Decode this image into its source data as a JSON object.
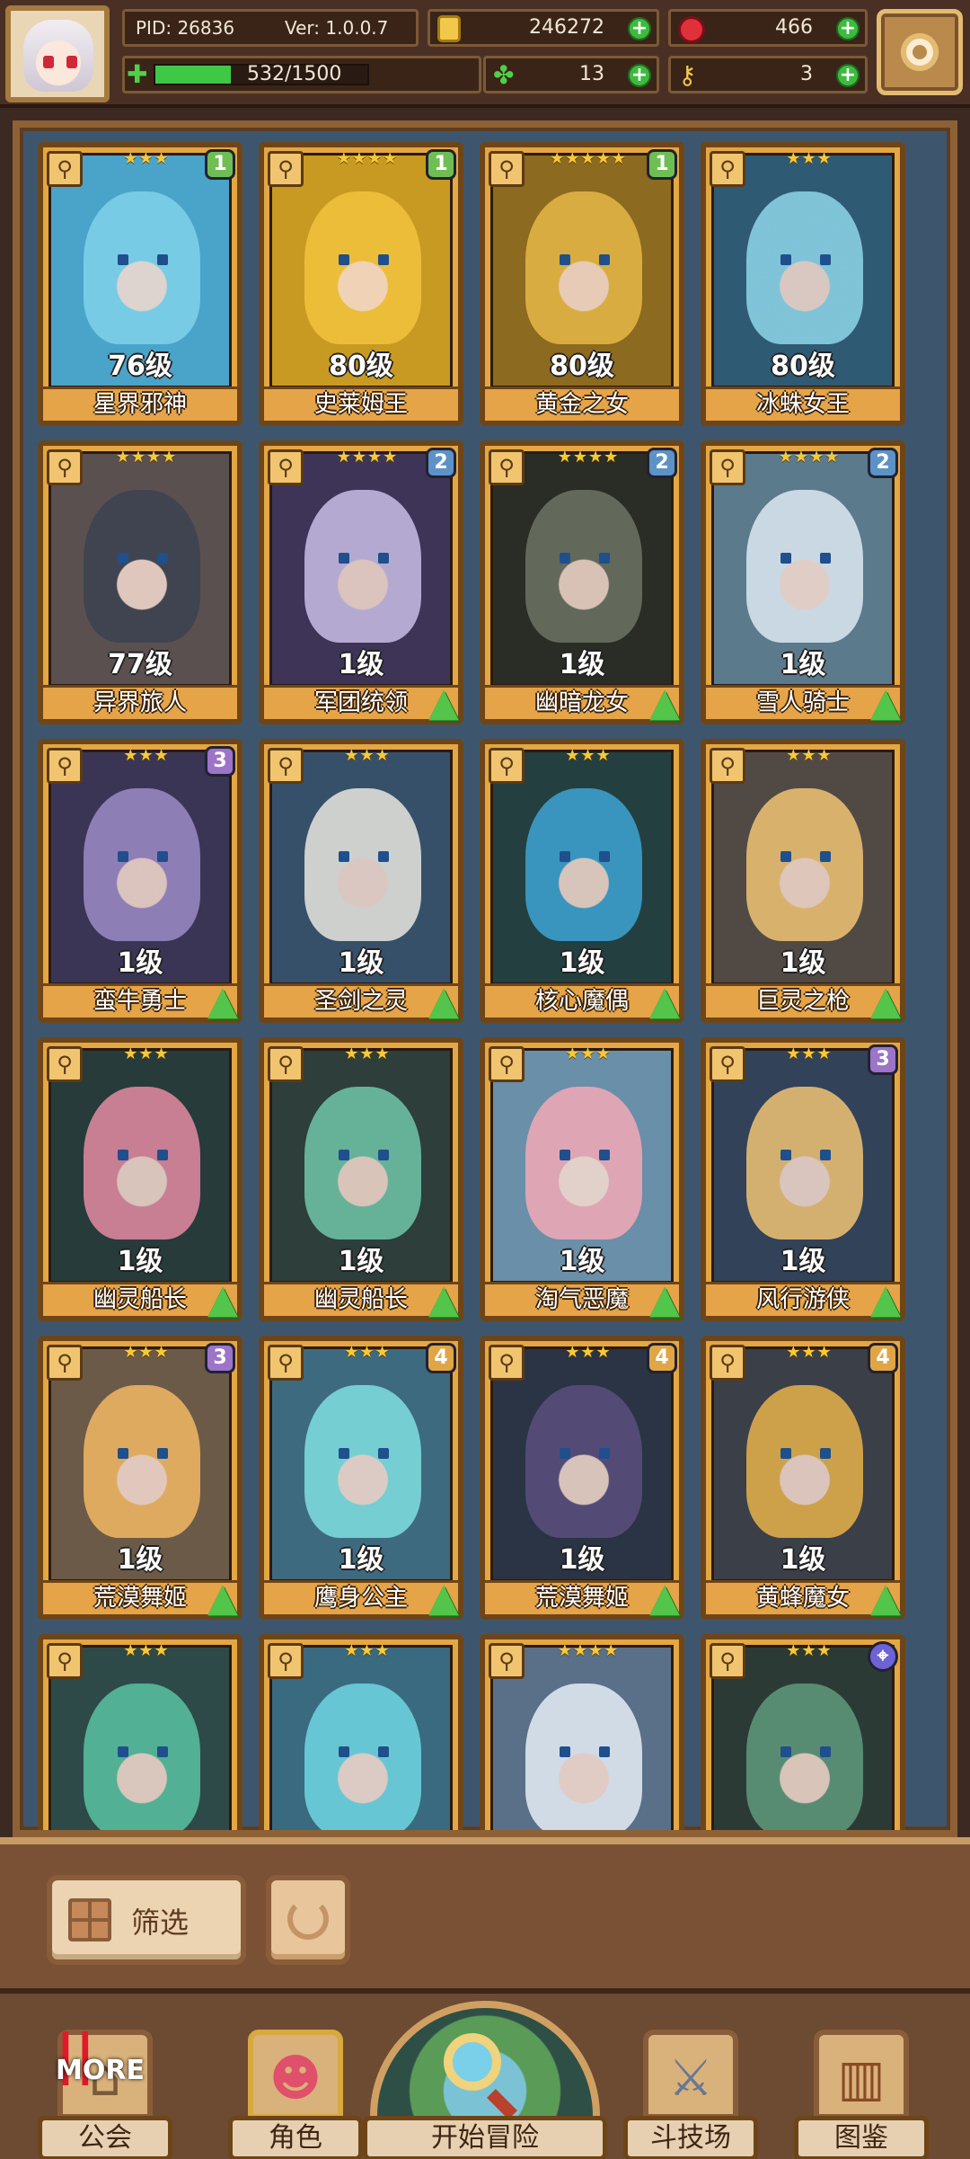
{
  "hud": {
    "pid": "PID: 26836",
    "version": "Ver: 1.0.0.7",
    "coins": "246272",
    "gems": "466",
    "exp": "532/1500",
    "exp_fraction": 0.355,
    "clovers": "13",
    "keys": "3",
    "plus_symbol": "+"
  },
  "cards": [
    {
      "name": "星界邪神",
      "level": "76级",
      "stars": "★★★",
      "badge": "1",
      "badge_color": "g",
      "art": "#4aa3c9",
      "skin": "#7fd2ea",
      "type": "⚲",
      "upgrade": false
    },
    {
      "name": "史莱姆王",
      "level": "80级",
      "stars": "★★★★",
      "badge": "1",
      "badge_color": "g",
      "art": "#c99a22",
      "skin": "#f2c33d",
      "type": "⚲",
      "upgrade": false
    },
    {
      "name": "黄金之女",
      "level": "80级",
      "stars": "★★★★★",
      "badge": "1",
      "badge_color": "g",
      "art": "#8c6a1f",
      "skin": "#e5b846",
      "type": "⚲",
      "upgrade": false
    },
    {
      "name": "冰蛛女王",
      "level": "80级",
      "stars": "★★★",
      "badge": "",
      "badge_color": "",
      "art": "#2f5a74",
      "skin": "#8ed6ea",
      "type": "⚲",
      "upgrade": false
    },
    {
      "name": "异界旅人",
      "level": "77级",
      "stars": "★★★★",
      "badge": "",
      "badge_color": "",
      "art": "#5b5050",
      "skin": "#3b4250",
      "type": "⚲",
      "upgrade": false
    },
    {
      "name": "军团统领",
      "level": "1级",
      "stars": "★★★★",
      "badge": "2",
      "badge_color": "b",
      "art": "#3e3458",
      "skin": "#c9bfe6",
      "type": "⚲",
      "upgrade": true
    },
    {
      "name": "幽暗龙女",
      "level": "1级",
      "stars": "★★★★",
      "badge": "2",
      "badge_color": "b",
      "art": "#2a2c26",
      "skin": "#6c7363",
      "type": "⚲",
      "upgrade": true
    },
    {
      "name": "雪人骑士",
      "level": "1级",
      "stars": "★★★★",
      "badge": "2",
      "badge_color": "b",
      "art": "#5b7a8c",
      "skin": "#dde9f2",
      "type": "⚲",
      "upgrade": true
    },
    {
      "name": "蛮牛勇士",
      "level": "1级",
      "stars": "★★★",
      "badge": "3",
      "badge_color": "p",
      "art": "#3a3554",
      "skin": "#9c8bc7",
      "type": "⚲",
      "upgrade": true
    },
    {
      "name": "圣剑之灵",
      "level": "1级",
      "stars": "★★★",
      "badge": "",
      "badge_color": "",
      "art": "#37506a",
      "skin": "#e8e6e0",
      "type": "⚲",
      "upgrade": true
    },
    {
      "name": "核心魔偶",
      "level": "1级",
      "stars": "★★★",
      "badge": "",
      "badge_color": "",
      "art": "#233f3f",
      "skin": "#3da4d3",
      "type": "⚲",
      "upgrade": true
    },
    {
      "name": "巨灵之枪",
      "level": "1级",
      "stars": "★★★",
      "badge": "",
      "badge_color": "",
      "art": "#514a44",
      "skin": "#f0c474",
      "type": "⚲",
      "upgrade": true
    },
    {
      "name": "幽灵船长",
      "level": "1级",
      "stars": "★★★",
      "badge": "",
      "badge_color": "",
      "art": "#263b3a",
      "skin": "#e58aa3",
      "type": "⚲",
      "upgrade": true
    },
    {
      "name": "幽灵船长",
      "level": "1级",
      "stars": "★★★",
      "badge": "",
      "badge_color": "",
      "art": "#2d3e3b",
      "skin": "#6fc6a8",
      "type": "⚲",
      "upgrade": true
    },
    {
      "name": "淘气恶魔",
      "level": "1级",
      "stars": "★★★",
      "badge": "",
      "badge_color": "",
      "art": "#6a8fa8",
      "skin": "#f2a9b6",
      "type": "⚲",
      "upgrade": true
    },
    {
      "name": "风行游侠",
      "level": "1级",
      "stars": "★★★",
      "badge": "3",
      "badge_color": "p",
      "art": "#324258",
      "skin": "#f0c474",
      "type": "⚲",
      "upgrade": true
    },
    {
      "name": "荒漠舞姬",
      "level": "1级",
      "stars": "★★★",
      "badge": "3",
      "badge_color": "p",
      "art": "#6b5a48",
      "skin": "#f2b863",
      "type": "⚲",
      "upgrade": true
    },
    {
      "name": "鹰身公主",
      "level": "1级",
      "stars": "★★★",
      "badge": "4",
      "badge_color": "o",
      "art": "#3e6a80",
      "skin": "#7fe0e0",
      "type": "⚲",
      "upgrade": true
    },
    {
      "name": "荒漠舞姬",
      "level": "1级",
      "stars": "★★★",
      "badge": "4",
      "badge_color": "o",
      "art": "#2a3444",
      "skin": "#5a4f7e",
      "type": "⚲",
      "upgrade": true
    },
    {
      "name": "黄蜂魔女",
      "level": "1级",
      "stars": "★★★",
      "badge": "4",
      "badge_color": "o",
      "art": "#3b3f48",
      "skin": "#e7b24a",
      "type": "⚲",
      "upgrade": true
    },
    {
      "name": "",
      "level": "",
      "stars": "★★★",
      "badge": "",
      "badge_color": "",
      "art": "#2e4a48",
      "skin": "#59c2a1",
      "type": "⚲",
      "upgrade": false
    },
    {
      "name": "",
      "level": "",
      "stars": "★★★",
      "badge": "",
      "badge_color": "",
      "art": "#3a6a80",
      "skin": "#6fd6e2",
      "type": "⚲",
      "upgrade": false
    },
    {
      "name": "",
      "level": "",
      "stars": "★★★★",
      "badge": "",
      "badge_color": "",
      "art": "#5a7088",
      "skin": "#e6eef6",
      "type": "⚲",
      "upgrade": false
    },
    {
      "name": "",
      "level": "",
      "stars": "★★★",
      "badge": "⌖",
      "badge_color": "cir",
      "art": "#2c3a36",
      "skin": "#5f9a7c",
      "type": "⚲",
      "upgrade": false
    }
  ],
  "actions": {
    "filter_label": "筛选"
  },
  "nav": {
    "guild": "公会",
    "role": "角色",
    "adventure": "开始冒险",
    "arena": "斗技场",
    "atlas": "图鉴",
    "more": "MORE"
  }
}
